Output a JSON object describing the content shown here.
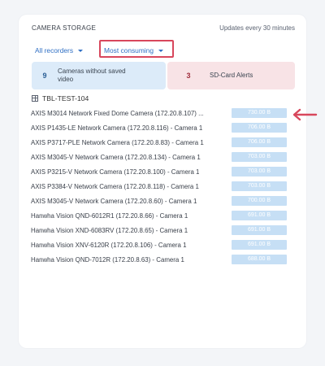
{
  "panel": {
    "title": "CAMERA STORAGE",
    "update_note": "Updates every 30 minutes"
  },
  "filters": {
    "recorders_label": "All recorders",
    "sort_label": "Most consuming"
  },
  "stats": {
    "no_saved": {
      "count": "9",
      "label": "Cameras without saved video"
    },
    "sd_alerts": {
      "count": "3",
      "label": "SD-Card Alerts"
    }
  },
  "site": {
    "name": "TBL-TEST-104"
  },
  "cameras": [
    {
      "name": "AXIS M3014 Network Fixed Dome Camera (172.20.8.107) ...",
      "size": "730.00 B",
      "fill": 1.0
    },
    {
      "name": "AXIS P1435-LE Network Camera (172.20.8.116) - Camera 1",
      "size": "706.00 B",
      "fill": 1.0
    },
    {
      "name": "AXIS P3717-PLE Network Camera (172.20.8.83) - Camera 1",
      "size": "706.00 B",
      "fill": 1.0
    },
    {
      "name": "AXIS M3045-V Network Camera (172.20.8.134) - Camera 1",
      "size": "703.00 B",
      "fill": 1.0
    },
    {
      "name": "AXIS P3215-V Network Camera (172.20.8.100) - Camera 1",
      "size": "703.00 B",
      "fill": 1.0
    },
    {
      "name": "AXIS P3384-V Network Camera (172.20.8.118) - Camera 1",
      "size": "703.00 B",
      "fill": 1.0
    },
    {
      "name": "AXIS M3045-V Network Camera (172.20.8.60) - Camera 1",
      "size": "700.00 B",
      "fill": 1.0
    },
    {
      "name": "Hanwha Vision QND-6012R1 (172.20.8.66) - Camera 1",
      "size": "691.00 B",
      "fill": 1.0
    },
    {
      "name": "Hanwha Vision XND-6083RV (172.20.8.65) - Camera 1",
      "size": "691.00 B",
      "fill": 1.0
    },
    {
      "name": "Hanwha Vision XNV-6120R (172.20.8.106) - Camera 1",
      "size": "691.00 B",
      "fill": 1.0
    },
    {
      "name": "Hanwha Vision QND-7012R (172.20.8.63) - Camera 1",
      "size": "688.00 B",
      "fill": 1.0
    }
  ],
  "colors": {
    "highlight": "#d8475c",
    "bar": "#c6dff5",
    "link": "#2f6fc4"
  }
}
